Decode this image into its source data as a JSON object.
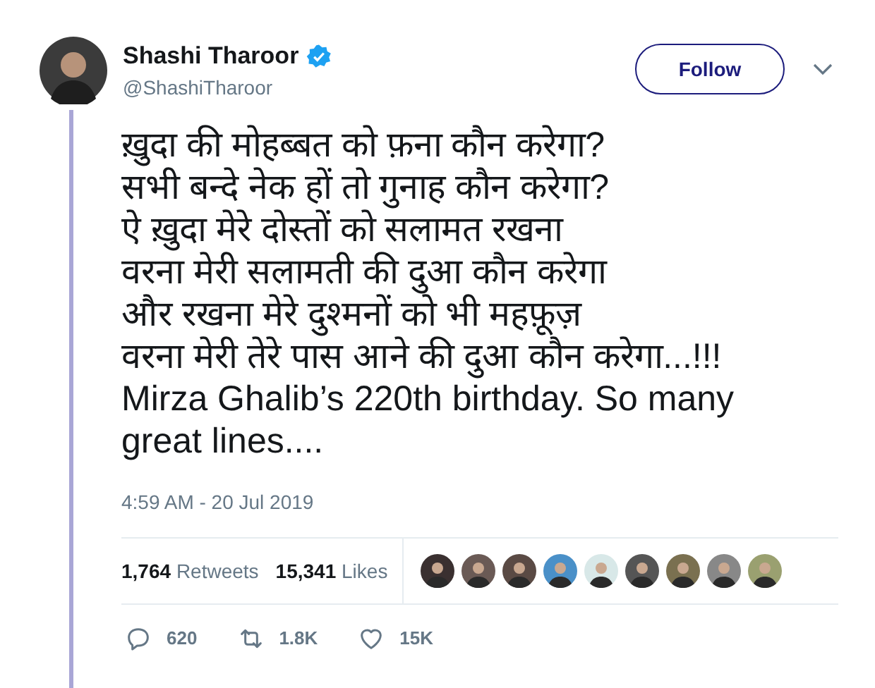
{
  "author": {
    "name": "Shashi Tharoor",
    "verified": true,
    "handle": "@ShashiTharoor"
  },
  "follow_button": {
    "label": "Follow"
  },
  "tweet": {
    "lines": [
      "ख़ुदा की मोहब्बत को फ़ना कौन करेगा?",
      "सभी बन्दे नेक हों तो गुनाह कौन करेगा?",
      "ऐ ख़ुदा मेरे दोस्तों को सलामत रखना",
      "वरना मेरी सलामती की दुआ कौन करेगा",
      "और रखना मेरे दुश्मनों को भी महफ़ूज़",
      "वरना मेरी तेरे पास आने की दुआ कौन करेगा...!!!",
      "Mirza Ghalib’s 220th birthday. So many",
      "great lines...."
    ],
    "timestamp": "4:59 AM - 20 Jul 2019"
  },
  "stats": [
    {
      "count": "1,764",
      "label": "Retweets"
    },
    {
      "count": "15,341",
      "label": "Likes"
    }
  ],
  "likers": [
    {
      "color": "#3a3030"
    },
    {
      "color": "#6a5a55"
    },
    {
      "color": "#5a4a44"
    },
    {
      "color": "#4a90c8"
    },
    {
      "color": "#d8e8e8"
    },
    {
      "color": "#555555"
    },
    {
      "color": "#7a7050"
    },
    {
      "color": "#888888"
    },
    {
      "color": "#9aa070"
    }
  ],
  "actions": [
    {
      "kind": "reply",
      "count": "620"
    },
    {
      "kind": "retweet",
      "count": "1.8K"
    },
    {
      "kind": "like",
      "count": "15K"
    }
  ]
}
